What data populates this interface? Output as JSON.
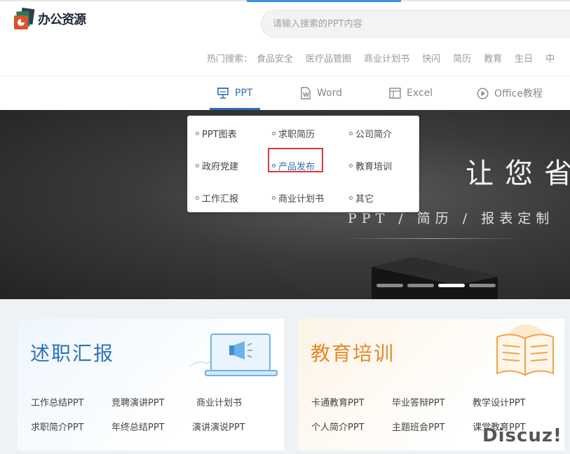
{
  "header": {
    "logo_text": "办公资源",
    "search_placeholder": "请输入搜索的PPT内容",
    "hot_label": "热门搜索：",
    "hot_items": [
      "食品安全",
      "医疗品管圈",
      "商业计划书",
      "快闪",
      "简历",
      "教育",
      "生日",
      "中"
    ]
  },
  "nav": {
    "items": [
      {
        "label": "PPT",
        "icon": "presentation-icon"
      },
      {
        "label": "Word",
        "icon": "word-doc-icon"
      },
      {
        "label": "Excel",
        "icon": "excel-sheet-icon"
      },
      {
        "label": "Office教程",
        "icon": "play-circle-icon"
      }
    ],
    "active": "PPT"
  },
  "dropdown": {
    "items": [
      "PPT图表",
      "求职简历",
      "公司简介",
      "政府党建",
      "产品发布",
      "教育培训",
      "工作汇报",
      "商业计划书",
      "其它"
    ],
    "highlighted": "产品发布"
  },
  "banner": {
    "title": "让您省",
    "subtitle": "PPT / 简历 / 报表定制",
    "slide_count": 4,
    "active_slide": 3
  },
  "cards": [
    {
      "title": "述职汇报",
      "links": [
        "工作总结PPT",
        "竞聘演讲PPT",
        "商业计划书",
        "求职简介PPT",
        "年终总结PPT",
        "演讲演说PPT"
      ]
    },
    {
      "title": "教育培训",
      "links": [
        "卡通教育PPT",
        "毕业答辩PPT",
        "教学设计PPT",
        "个人简介PPT",
        "主题班会PPT",
        "课堂教育PPT"
      ]
    }
  ],
  "watermark": "Discuz!",
  "colors": {
    "accent_blue": "#2f6fb5",
    "highlight_red": "#d93a3a",
    "education_orange": "#e08a2a"
  }
}
